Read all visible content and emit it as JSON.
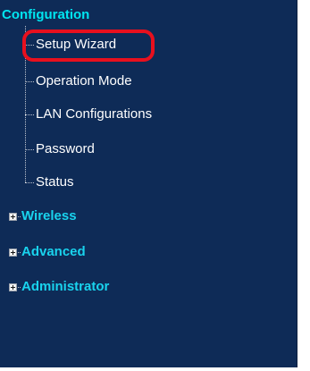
{
  "colors": {
    "panel_bg": "#0e2b57",
    "section_title": "#00e5f0",
    "item_text": "#ffffff",
    "group_text": "#19d3ee",
    "highlight": "#e8101e"
  },
  "menu": {
    "section_title": "Configuration",
    "items": [
      {
        "label": "Setup Wizard"
      },
      {
        "label": "Operation Mode"
      },
      {
        "label": "LAN Configurations"
      },
      {
        "label": "Password"
      },
      {
        "label": "Status"
      }
    ],
    "groups": [
      {
        "label": "Wireless",
        "icon": "plus-expander-icon"
      },
      {
        "label": "Advanced",
        "icon": "plus-expander-icon"
      },
      {
        "label": "Administrator",
        "icon": "plus-expander-icon"
      }
    ]
  }
}
